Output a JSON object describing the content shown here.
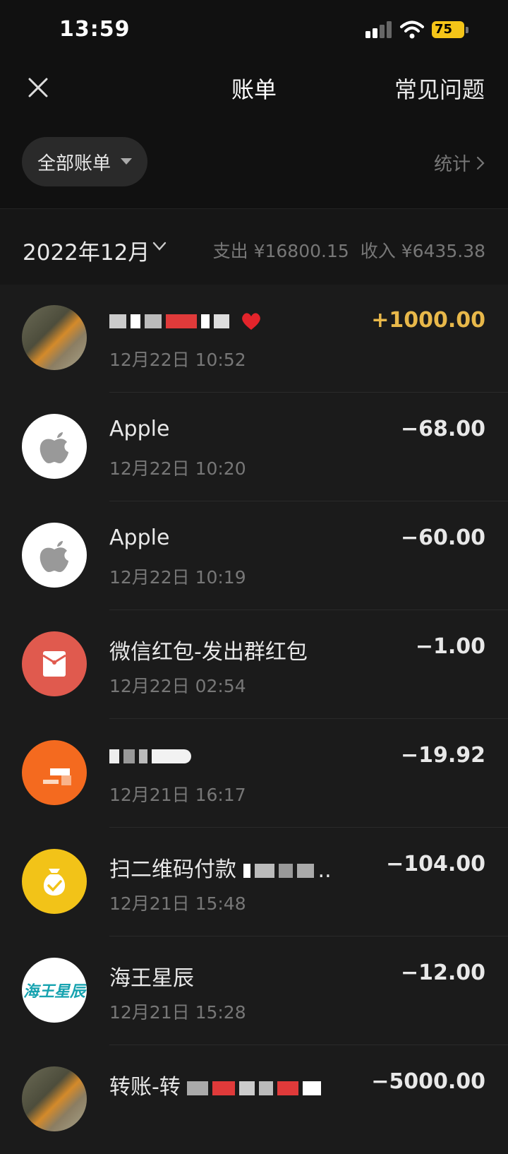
{
  "status_bar": {
    "time": "13:59",
    "battery": "75"
  },
  "nav": {
    "title": "账单",
    "faq": "常见问题"
  },
  "filter": {
    "label": "全部账单",
    "stats_label": "统计"
  },
  "month": {
    "label": "2022年12月",
    "expense": "支出 ¥16800.15",
    "income": "收入 ¥6435.38"
  },
  "transactions": [
    {
      "name": "",
      "time": "12月22日 10:52",
      "amount": "+1000.00",
      "icon": "photo-avatar"
    },
    {
      "name": "Apple",
      "time": "12月22日 10:20",
      "amount": "−68.00",
      "icon": "apple-icon"
    },
    {
      "name": "Apple",
      "time": "12月22日 10:19",
      "amount": "−60.00",
      "icon": "apple-icon"
    },
    {
      "name": "微信红包-发出群红包",
      "time": "12月22日 02:54",
      "amount": "−1.00",
      "icon": "red-envelope-icon"
    },
    {
      "name": "",
      "time": "12月21日 16:17",
      "amount": "−19.92",
      "icon": "orange-merchant-icon"
    },
    {
      "name": "扫二维码付款",
      "time": "12月21日 15:48",
      "amount": "−104.00",
      "icon": "money-bag-icon"
    },
    {
      "name": "海王星辰",
      "time": "12月21日 15:28",
      "amount": "−12.00",
      "icon": "haiwang-logo",
      "logo_text": "海王星辰"
    },
    {
      "name": "转账-转",
      "time": "",
      "amount": "−5000.00",
      "icon": "photo-avatar"
    }
  ],
  "colors": {
    "income": "#e8b84a",
    "background": "#1b1b1b",
    "header": "#111111"
  }
}
